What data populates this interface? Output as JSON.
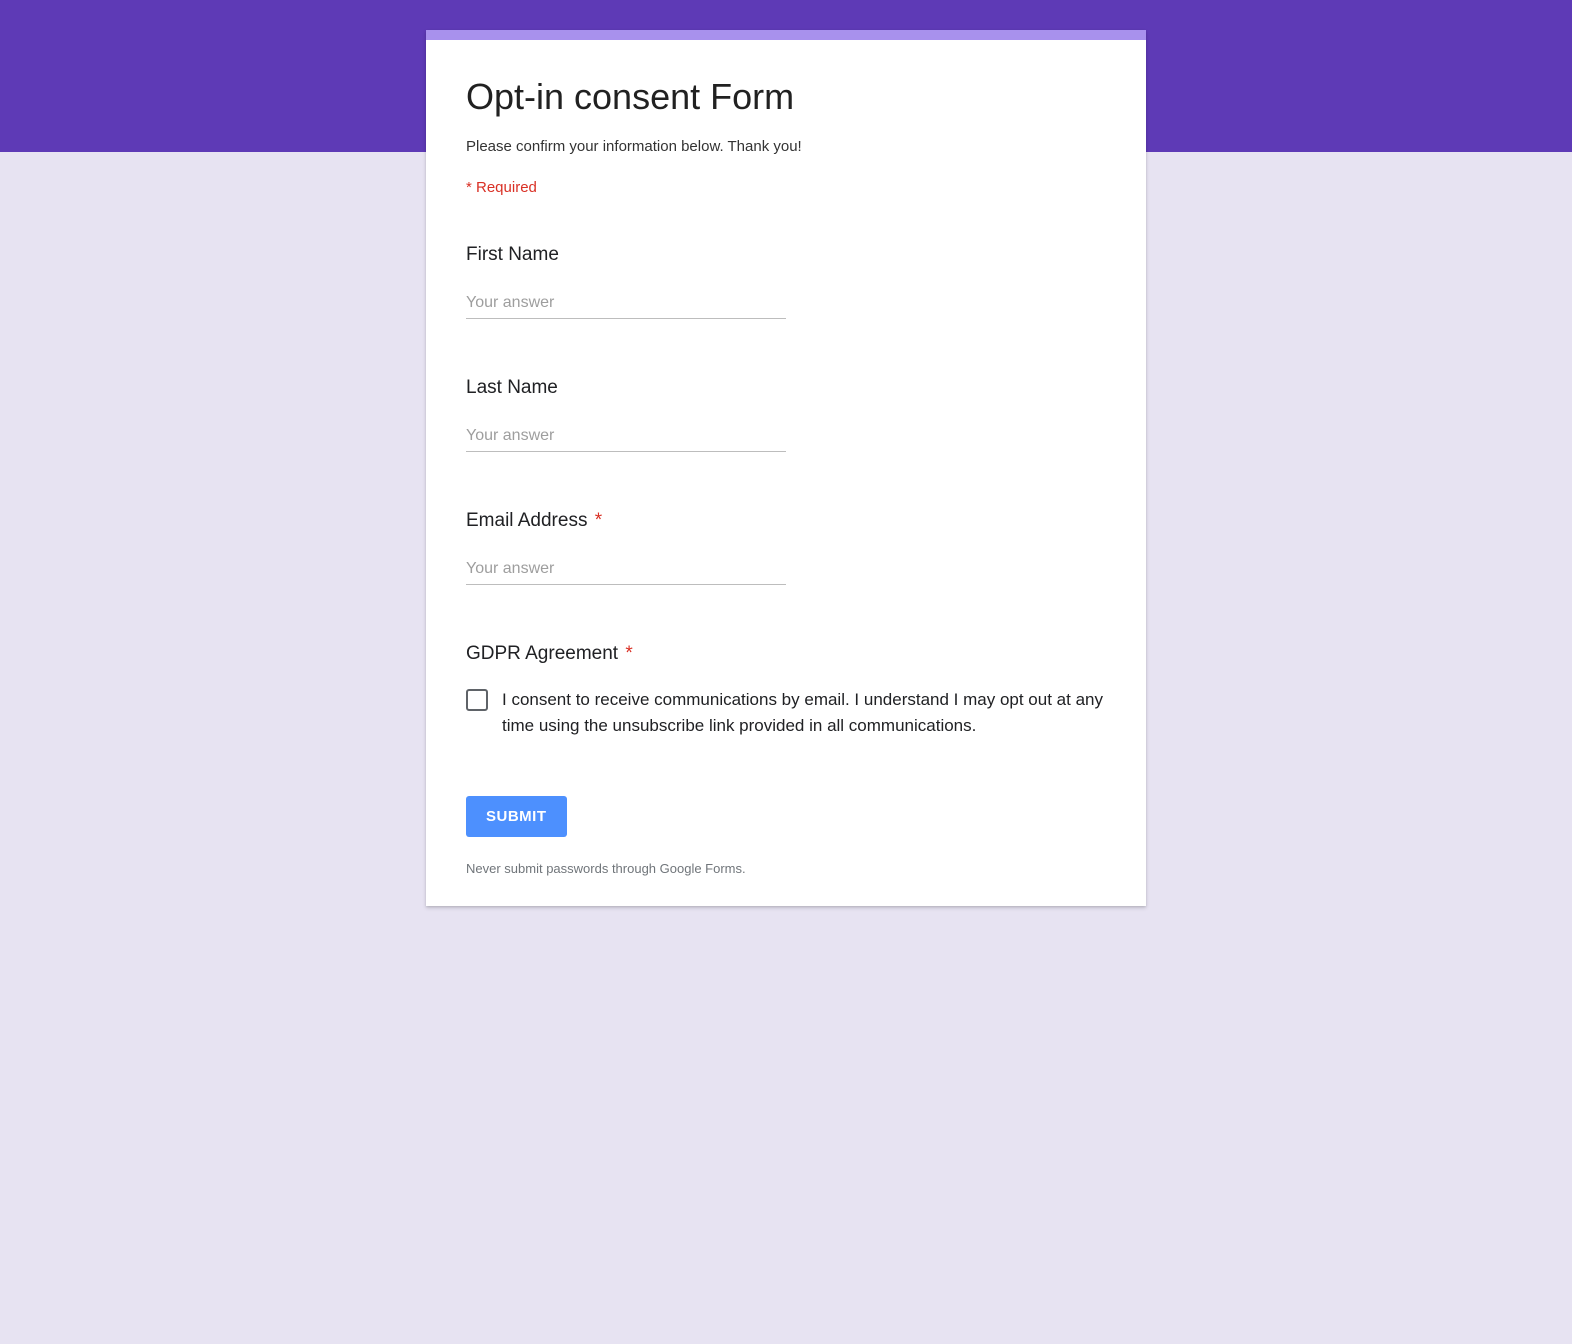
{
  "form": {
    "title": "Opt-in consent Form",
    "description": "Please confirm your information below. Thank you!",
    "required_note": "* Required",
    "fields": {
      "first_name": {
        "label": "First Name",
        "placeholder": "Your answer",
        "required": false
      },
      "last_name": {
        "label": "Last Name",
        "placeholder": "Your answer",
        "required": false
      },
      "email": {
        "label": "Email Address",
        "placeholder": "Your answer",
        "required": true,
        "asterisk": "*"
      },
      "gdpr": {
        "label": "GDPR Agreement",
        "required": true,
        "asterisk": "*",
        "consent_text": "I consent to receive communications by email. I understand I may opt out at any time using the unsubscribe link provided in all communications."
      }
    },
    "submit_label": "SUBMIT",
    "disclaimer": "Never submit passwords through Google Forms."
  }
}
